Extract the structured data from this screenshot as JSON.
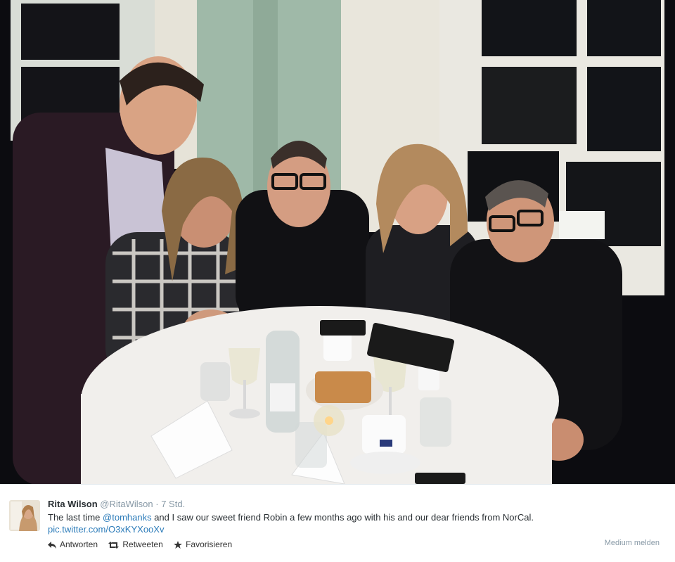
{
  "photo": {
    "alt_icon": "group-photo-restaurant"
  },
  "tweet": {
    "author": {
      "name": "Rita Wilson",
      "handle": "@RitaWilson",
      "separator": "·",
      "time": "7 Std.",
      "avatar_icon": "avatar-rita-wilson"
    },
    "text": {
      "part1": "The last time ",
      "mention": "@tomhanks",
      "part2": " and I saw our sweet friend Robin a few months ago with his and our dear friends from NorCal.",
      "link": "pic.twitter.com/O3xKYXooXv"
    },
    "actions": {
      "reply": {
        "label": "Antworten",
        "icon": "reply-icon"
      },
      "retweet": {
        "label": "Retweeten",
        "icon": "retweet-icon"
      },
      "favorite": {
        "label": "Favorisieren",
        "icon": "star-icon"
      }
    },
    "report_label": "Medium melden"
  },
  "colors": {
    "link": "#2b7bb9",
    "muted": "#8899a6",
    "text": "#292f33"
  }
}
